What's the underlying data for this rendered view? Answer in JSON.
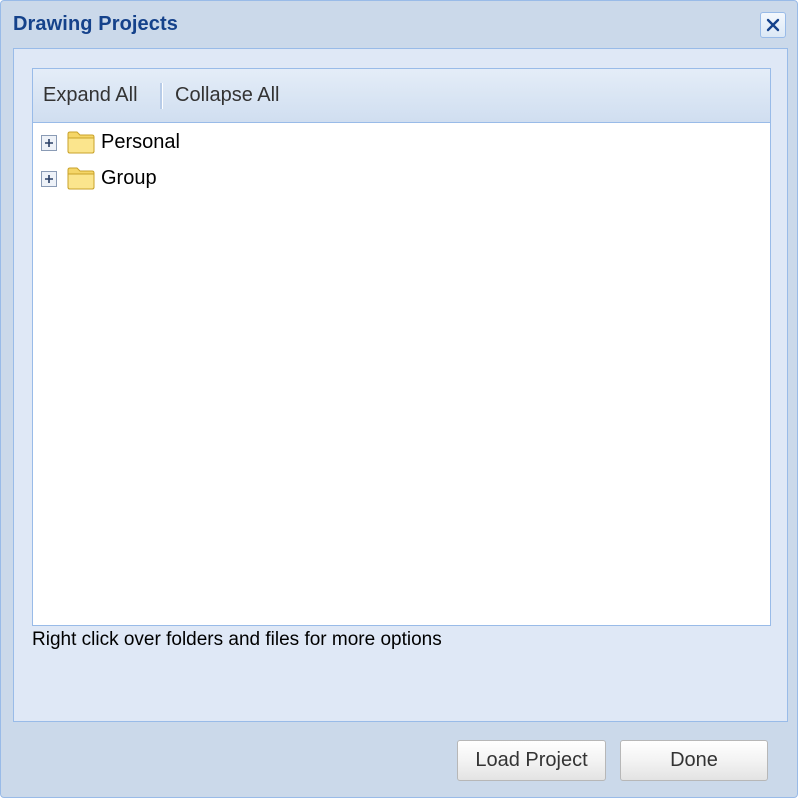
{
  "window": {
    "title": "Drawing Projects",
    "close_icon": "close-icon"
  },
  "toolbar": {
    "expand_all": "Expand All",
    "collapse_all": "Collapse All"
  },
  "tree": {
    "nodes": [
      {
        "label": "Personal",
        "icon": "folder-icon",
        "expander": "plus-icon",
        "expanded": false
      },
      {
        "label": "Group",
        "icon": "folder-icon",
        "expander": "plus-icon",
        "expanded": false
      }
    ]
  },
  "hint": "Right click over folders and files for more options",
  "buttons": {
    "load_project": "Load Project",
    "done": "Done"
  },
  "colors": {
    "title": "#15428b",
    "window_bg": "#cbd9ea",
    "panel_bg": "#dfe8f6",
    "border": "#99bbe8"
  }
}
